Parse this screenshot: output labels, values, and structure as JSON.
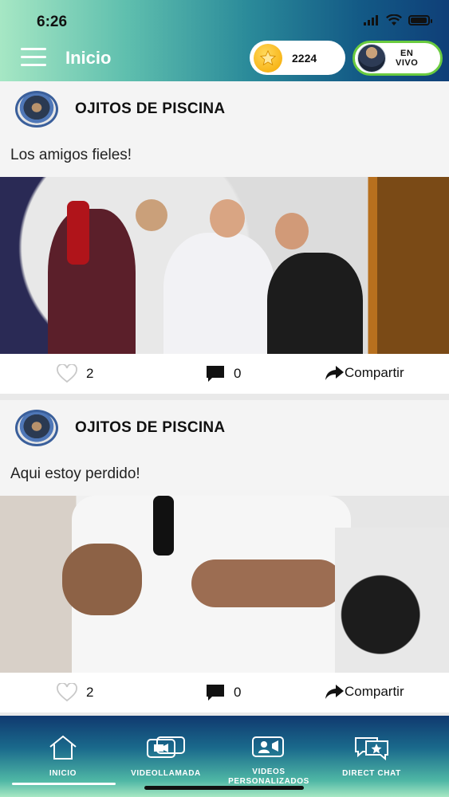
{
  "status_bar": {
    "time": "6:26"
  },
  "header": {
    "title": "Inicio",
    "coins": "2224",
    "live_label_1": "EN",
    "live_label_2": "VIVO"
  },
  "posts": [
    {
      "author": "OJITOS DE PISCINA",
      "text": "Los amigos fieles!",
      "likes": "2",
      "comments": "0",
      "share_label": "Compartir"
    },
    {
      "author": "OJITOS DE PISCINA",
      "text": "Aqui estoy perdido!",
      "likes": "2",
      "comments": "0",
      "share_label": "Compartir"
    }
  ],
  "bottom_nav": {
    "items": [
      {
        "label": "INICIO",
        "icon": "home-icon"
      },
      {
        "label": "VIDEOLLAMADA",
        "icon": "video-call-icon"
      },
      {
        "label_1": "VIDEOS",
        "label_2": "PERSONALIZADOS",
        "icon": "personalized-video-icon"
      },
      {
        "label": "DIRECT CHAT",
        "icon": "direct-chat-icon"
      }
    ]
  },
  "colors": {
    "accent_green": "#6acb3f",
    "header_start": "#a6e7c4",
    "header_end": "#0f3f78",
    "coin_gold": "#f5a800"
  }
}
